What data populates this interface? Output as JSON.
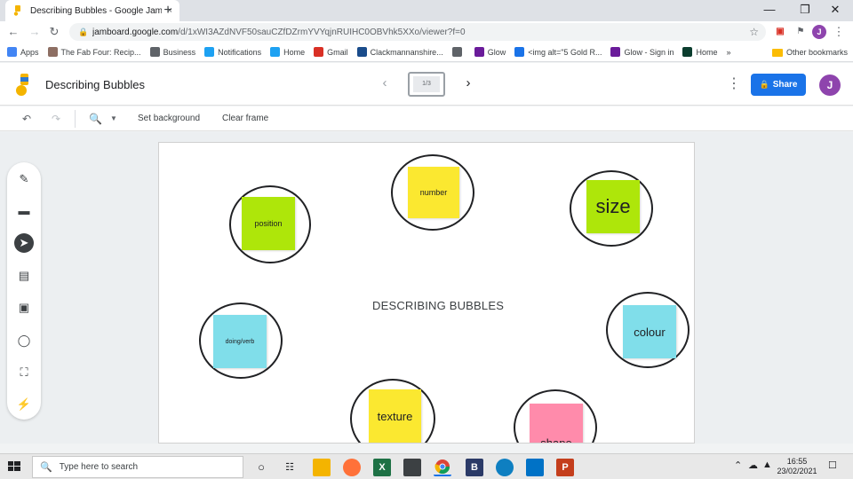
{
  "browser": {
    "tab_title": "Describing Bubbles - Google Jam",
    "tab_close": "×",
    "new_tab": "+",
    "window_controls": [
      "—",
      "❐",
      "✕"
    ],
    "url_host": "jamboard.google.com",
    "url_path": "/d/1xWI3AZdNVF50sauCZfDZrmYVYqjnRUIHC0OBVhk5XXo/viewer?f=0",
    "profile_initial": "J",
    "bookmarks": [
      {
        "label": "Apps",
        "icon": "apps-grid-icon",
        "color": "#4285f4"
      },
      {
        "label": "The Fab Four: Recip...",
        "icon": "page-icon",
        "color": "#8d6e63"
      },
      {
        "label": "Business",
        "icon": "globe-icon",
        "color": "#5f6368"
      },
      {
        "label": "Notifications",
        "icon": "twitter-icon",
        "color": "#1da1f2"
      },
      {
        "label": "Home",
        "icon": "twitter-icon",
        "color": "#1da1f2"
      },
      {
        "label": "Gmail",
        "icon": "gmail-icon",
        "color": "#d93025"
      },
      {
        "label": "Clackmannanshire...",
        "icon": "page-icon",
        "color": "#1a4c8b"
      },
      {
        "label": "",
        "icon": "globe-icon",
        "color": "#5f6368"
      },
      {
        "label": "Glow",
        "icon": "glow-icon",
        "color": "#6a1b9a"
      },
      {
        "label": "<img alt=\"5 Gold R...",
        "icon": "play-icon",
        "color": "#1a73e8"
      },
      {
        "label": "Glow - Sign in",
        "icon": "glow-icon",
        "color": "#6a1b9a"
      },
      {
        "label": "Home",
        "icon": "page-icon",
        "color": "#0b3d2e"
      }
    ],
    "bookmarks_overflow": "»",
    "other_bookmarks": "Other bookmarks"
  },
  "jamboard": {
    "title": "Describing Bubbles",
    "frame_label": "1/3",
    "share_label": "Share",
    "user_initial": "J",
    "tools_row": {
      "set_background": "Set background",
      "clear_frame": "Clear frame"
    }
  },
  "canvas": {
    "heading": "DESCRIBING BUBBLES",
    "notes": [
      {
        "label": "position",
        "color": "#aee60a"
      },
      {
        "label": "number",
        "color": "#fbe830"
      },
      {
        "label": "size",
        "color": "#aee60a"
      },
      {
        "label": "doing/verb",
        "color": "#80deea"
      },
      {
        "label": "colour",
        "color": "#80deea"
      },
      {
        "label": "texture",
        "color": "#fbe830"
      },
      {
        "label": "shape",
        "color": "#ff8bab"
      }
    ]
  },
  "taskbar": {
    "search_placeholder": "Type here to search",
    "time": "16:55",
    "date": "23/02/2021"
  },
  "colors": {
    "accent": "#1a73e8",
    "avatar": "#8e44ad"
  }
}
